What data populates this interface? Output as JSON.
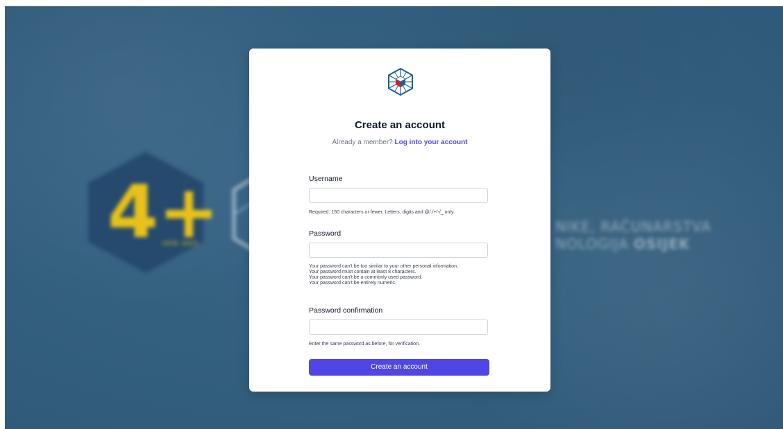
{
  "background": {
    "badge_text": "4+",
    "years": "1978. 2023.",
    "wordmark_line1": "NIKE, RAČUNARSTVA",
    "wordmark_line2_prefix": "NOLOGIJA",
    "wordmark_line2_bold": "OSIJEK",
    "colors": {
      "backdrop": "#34607f",
      "badge_fill": "#254a6d",
      "badge_accent": "#e8c21a"
    }
  },
  "card": {
    "logo_icon": "hex-cube-logo-icon",
    "title": "Create an account",
    "member_prompt": "Already a member?",
    "login_link": "Log into your account",
    "fields": {
      "username": {
        "label": "Username",
        "value": "",
        "help": "Required. 150 characters or fewer. Letters, digits and @/./+/-/_ only."
      },
      "password": {
        "label": "Password",
        "value": "",
        "help": [
          "Your password can’t be too similar to your other personal information.",
          "Your password must contain at least 8 characters.",
          "Your password can’t be a commonly used password.",
          "Your password can’t be entirely numeric."
        ]
      },
      "password_confirmation": {
        "label": "Password confirmation",
        "value": "",
        "help": "Enter the same password as before, for verification."
      }
    },
    "submit_label": "Create an account",
    "colors": {
      "accent": "#4f46e5",
      "title": "#111827",
      "muted": "#6b7280",
      "logo_red": "#d0212a",
      "logo_blue": "#1f5d94"
    }
  }
}
